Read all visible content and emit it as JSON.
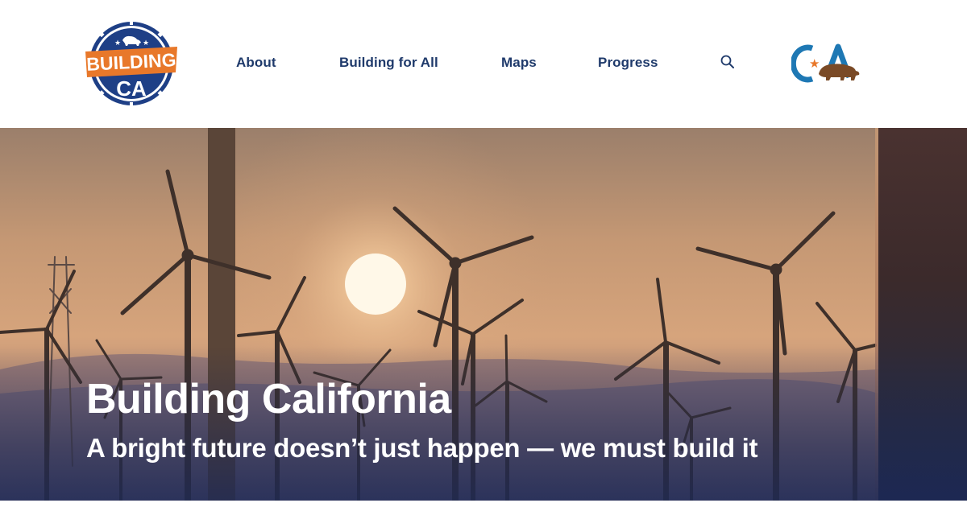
{
  "header": {
    "logo": {
      "line1": "BUILDING",
      "line2": "CA",
      "icon": "california-bear-badge-icon"
    },
    "nav": [
      {
        "label": "About"
      },
      {
        "label": "Building for All"
      },
      {
        "label": "Maps"
      },
      {
        "label": "Progress"
      }
    ],
    "search_icon": "search-icon",
    "ca_logo": {
      "text": "CA",
      "icon": "ca-state-bear-logo-icon"
    }
  },
  "hero": {
    "title": "Building California",
    "subtitle": "A bright future doesn’t just happen — we must build it",
    "image": "wind-turbines-at-sunset-photo"
  },
  "colors": {
    "nav_text": "#1f3a6b",
    "badge_blue": "#1e3f86",
    "badge_orange": "#e8782a",
    "sky_top": "#9b7f6b",
    "sun": "#fff6df"
  }
}
